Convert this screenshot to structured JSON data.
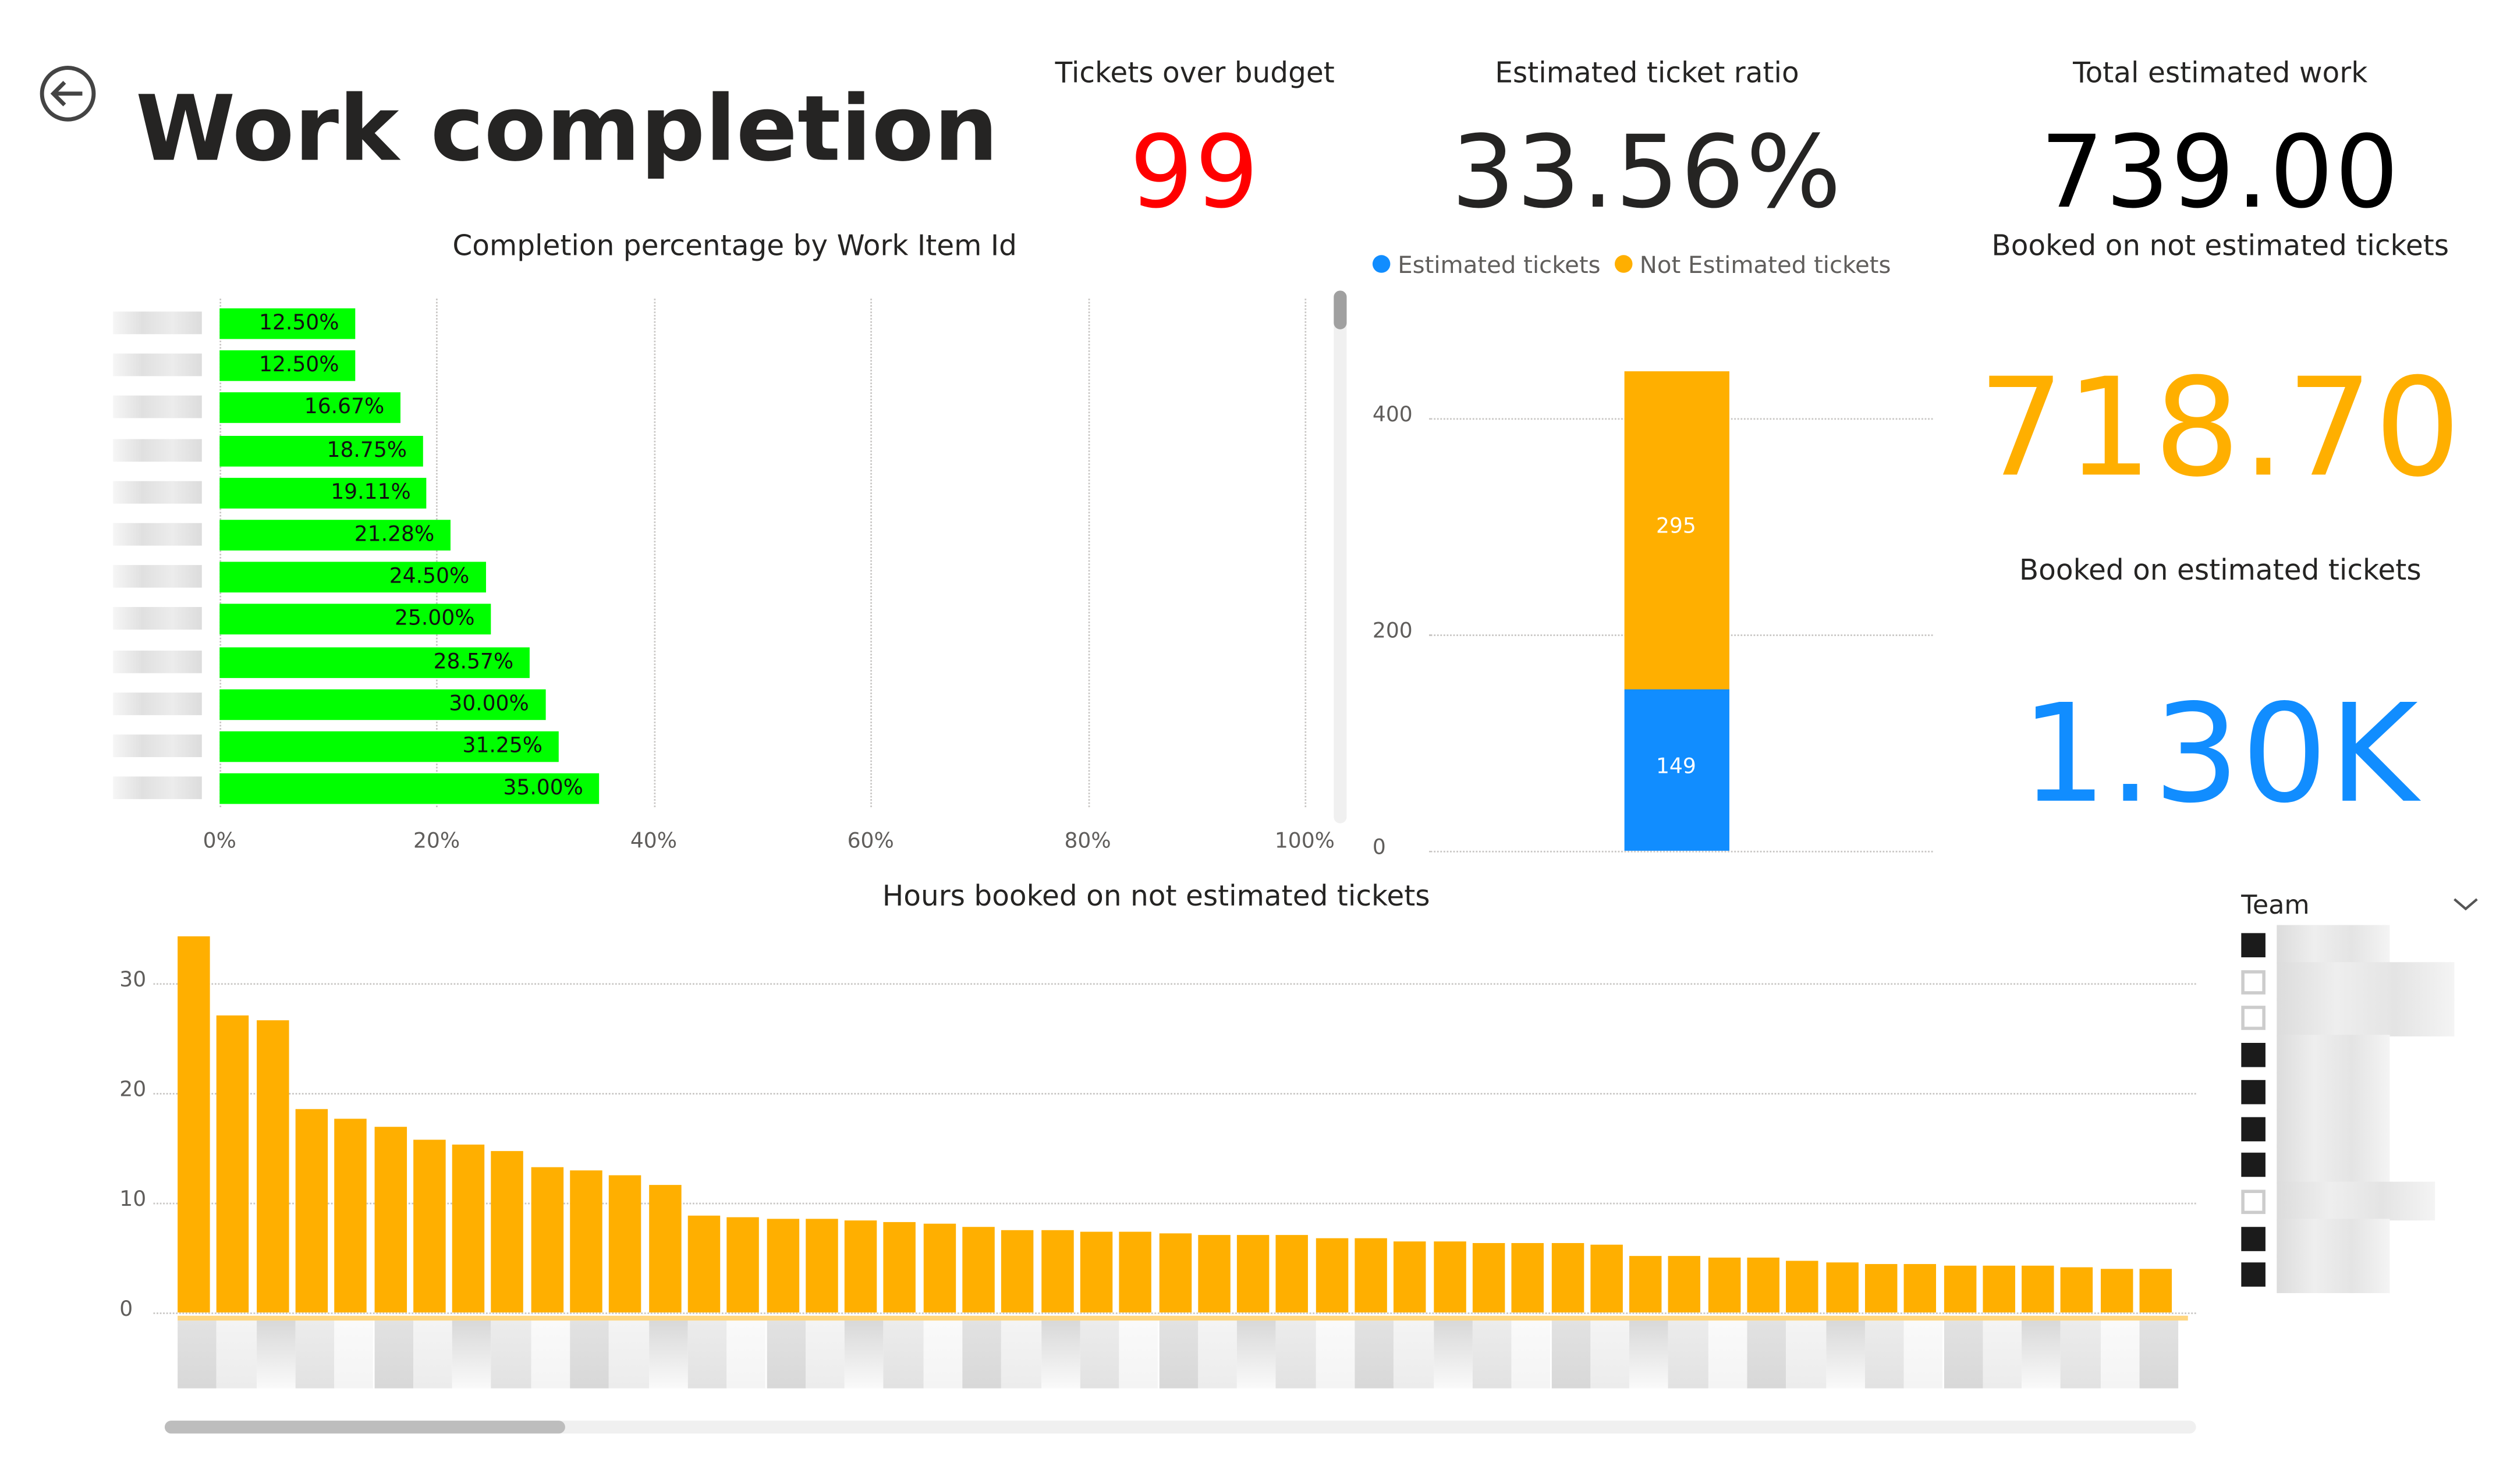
{
  "header": {
    "title": "Work completion",
    "back_icon": "back-arrow-icon"
  },
  "kpis": {
    "tickets_over_budget": {
      "label": "Tickets over budget",
      "value": "99",
      "color": "#FF0000"
    },
    "estimated_ticket_ratio": {
      "label": "Estimated ticket ratio",
      "value": "33.56%",
      "color": "#252423"
    },
    "total_estimated_work": {
      "label": "Total estimated work",
      "value": "739.00",
      "color": "#000000"
    },
    "booked_not_estimated": {
      "label": "Booked on not estimated tickets",
      "value": "718.70",
      "color": "#FFAF00"
    },
    "booked_estimated": {
      "label": "Booked on estimated tickets",
      "value": "1.30K",
      "color": "#118DFF"
    }
  },
  "slicer": {
    "title": "Team",
    "checked": [
      true,
      false,
      false,
      true,
      true,
      true,
      true,
      false,
      true,
      true
    ]
  },
  "chart_data": [
    {
      "type": "bar",
      "orientation": "horizontal",
      "title": "Completion percentage by Work Item Id",
      "values": [
        12.5,
        12.5,
        16.67,
        18.75,
        19.11,
        21.28,
        24.5,
        25.0,
        28.57,
        30.0,
        31.25,
        35.0
      ],
      "labels": [
        "12.50%",
        "12.50%",
        "16.67%",
        "18.75%",
        "19.11%",
        "21.28%",
        "24.50%",
        "25.00%",
        "28.57%",
        "30.00%",
        "31.25%",
        "35.00%"
      ],
      "xticks": [
        "0%",
        "20%",
        "40%",
        "60%",
        "80%",
        "100%"
      ],
      "xlim": [
        0,
        100
      ],
      "color": "#00FF00"
    },
    {
      "type": "bar",
      "stacked": true,
      "title": "",
      "legend": [
        {
          "name": "Estimated tickets",
          "color": "#118DFF"
        },
        {
          "name": "Not Estimated tickets",
          "color": "#FFAF00"
        }
      ],
      "series": [
        {
          "name": "Estimated tickets",
          "values": [
            149
          ]
        },
        {
          "name": "Not Estimated tickets",
          "values": [
            295
          ]
        }
      ],
      "yticks": [
        "0",
        "200",
        "400"
      ],
      "ylim": [
        0,
        450
      ]
    },
    {
      "type": "bar",
      "title": "Hours booked on not estimated tickets",
      "values": [
        34.2,
        27.0,
        26.6,
        18.6,
        17.6,
        16.9,
        15.8,
        15.3,
        14.7,
        13.2,
        12.9,
        12.5,
        11.6,
        8.8,
        8.7,
        8.5,
        8.5,
        8.4,
        8.3,
        8.1,
        7.8,
        7.5,
        7.5,
        7.3,
        7.3,
        7.2,
        7.0,
        7.0,
        7.0,
        6.8,
        6.8,
        6.5,
        6.5,
        6.3,
        6.3,
        6.3,
        6.2,
        5.2,
        5.2,
        5.0,
        5.0,
        4.7,
        4.5,
        4.4,
        4.4,
        4.3,
        4.3,
        4.2,
        4.1,
        4.0,
        4.0
      ],
      "yticks": [
        "0",
        "10",
        "20",
        "30"
      ],
      "ylim": [
        0,
        35
      ],
      "color": "#FFAF00"
    }
  ]
}
